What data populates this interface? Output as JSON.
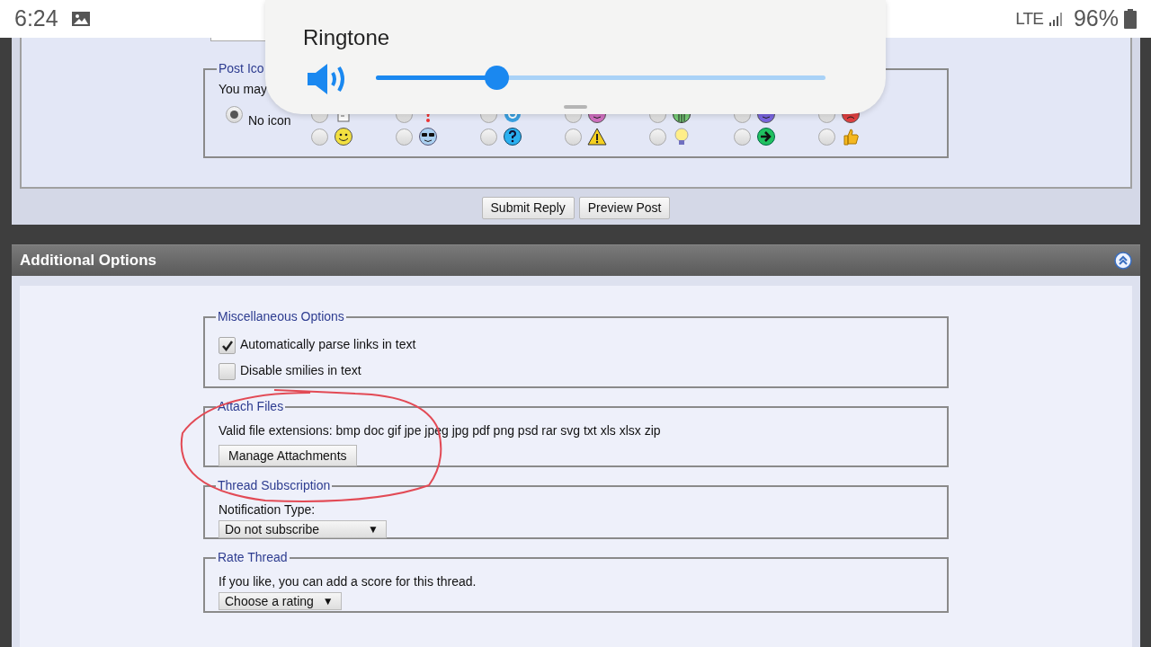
{
  "status_bar": {
    "time": "6:24",
    "network": "LTE",
    "battery": "96%"
  },
  "volume_panel": {
    "title": "Ringtone",
    "level": 0.27
  },
  "post_icons": {
    "legend": "Post Ico",
    "hint": "You may",
    "options": [
      {
        "kind": "none",
        "label": "No icon",
        "selected": true
      },
      {
        "kind": "document",
        "selected": false
      },
      {
        "kind": "exclamation",
        "selected": false
      },
      {
        "kind": "ring",
        "selected": false
      },
      {
        "kind": "laugh-face",
        "selected": false
      },
      {
        "kind": "grid",
        "selected": false
      },
      {
        "kind": "smiley-face",
        "selected": false
      },
      {
        "kind": "angry",
        "selected": false
      },
      {
        "kind": "smile",
        "selected": false
      },
      {
        "kind": "cool",
        "selected": false
      },
      {
        "kind": "question",
        "selected": false
      },
      {
        "kind": "warning",
        "selected": false
      },
      {
        "kind": "lightbulb",
        "selected": false
      },
      {
        "kind": "arrow",
        "selected": false
      },
      {
        "kind": "thumbs-up",
        "selected": false
      }
    ]
  },
  "buttons": [
    {
      "label": "Submit Reply"
    },
    {
      "label": "Preview Post"
    }
  ],
  "additional_options": {
    "title": "Additional Options",
    "expanded": true,
    "groups": [
      {
        "kind": "checkboxes",
        "legend": "Miscellaneous Options",
        "items": [
          {
            "label": "Automatically parse links in text",
            "checked": true
          },
          {
            "label": "Disable smilies in text",
            "checked": false
          }
        ]
      },
      {
        "kind": "attach",
        "legend": "Attach Files",
        "text": "Valid file extensions: bmp doc gif jpe jpeg jpg pdf png psd rar svg txt xls xlsx zip",
        "button": "Manage Attachments"
      },
      {
        "kind": "select",
        "legend": "Thread Subscription",
        "label": "Notification Type:",
        "value": "Do not subscribe",
        "arrow": "▼"
      },
      {
        "kind": "select",
        "legend": "Rate Thread",
        "label": "If you like, you can add a score for this thread.",
        "value": "Choose a rating",
        "arrow": "▼"
      }
    ]
  }
}
